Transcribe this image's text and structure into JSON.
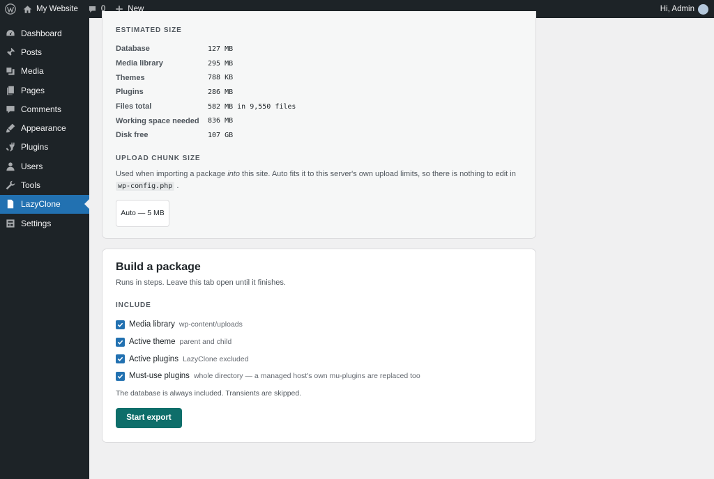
{
  "adminbar": {
    "site_name": "My Website",
    "comments_count": "0",
    "new_label": "New",
    "greeting": "Hi, Admin"
  },
  "sidebar": {
    "items": [
      {
        "label": "Dashboard",
        "icon": "dashboard-icon"
      },
      {
        "label": "Posts",
        "icon": "pin-icon"
      },
      {
        "label": "Media",
        "icon": "media-icon"
      },
      {
        "label": "Pages",
        "icon": "pages-icon"
      },
      {
        "label": "Comments",
        "icon": "comment-icon"
      },
      {
        "label": "Appearance",
        "icon": "brush-icon"
      },
      {
        "label": "Plugins",
        "icon": "plug-icon"
      },
      {
        "label": "Users",
        "icon": "user-icon"
      },
      {
        "label": "Tools",
        "icon": "wrench-icon"
      },
      {
        "label": "LazyClone",
        "icon": "file-icon",
        "active": true
      },
      {
        "label": "Settings",
        "icon": "settings-icon"
      }
    ]
  },
  "estimated_size": {
    "label": "ESTIMATED SIZE",
    "rows": [
      {
        "key": "Database",
        "value": "127 MB"
      },
      {
        "key": "Media library",
        "value": "295 MB"
      },
      {
        "key": "Themes",
        "value": "788 KB"
      },
      {
        "key": "Plugins",
        "value": "286 MB"
      },
      {
        "key": "Files total",
        "value": "582 MB in 9,550 files"
      },
      {
        "key": "Working space needed",
        "value": "836 MB"
      },
      {
        "key": "Disk free",
        "value": "107 GB"
      }
    ]
  },
  "upload_chunk": {
    "label": "UPLOAD CHUNK SIZE",
    "desc_before": "Used when importing a package ",
    "desc_em": "into",
    "desc_after": " this site. Auto fits it to this server's own upload limits, so there is nothing to edit in ",
    "desc_code": "wp-config.php",
    "desc_end": " .",
    "value": "Auto — 5 MB"
  },
  "build": {
    "title": "Build a package",
    "subtitle": "Runs in steps. Leave this tab open until it finishes.",
    "include_label": "INCLUDE",
    "options": [
      {
        "label": "Media library",
        "hint": "wp-content/uploads"
      },
      {
        "label": "Active theme",
        "hint": "parent and child"
      },
      {
        "label": "Active plugins",
        "hint": "LazyClone excluded"
      },
      {
        "label": "Must-use plugins",
        "hint": "whole directory — a managed host's own mu-plugins are replaced too"
      }
    ],
    "note": "The database is always included. Transients are skipped.",
    "export_label": "Start export"
  },
  "colors": {
    "accent": "#2271b1",
    "export_button": "#0e6e6a",
    "admin_dark": "#1d2327"
  }
}
